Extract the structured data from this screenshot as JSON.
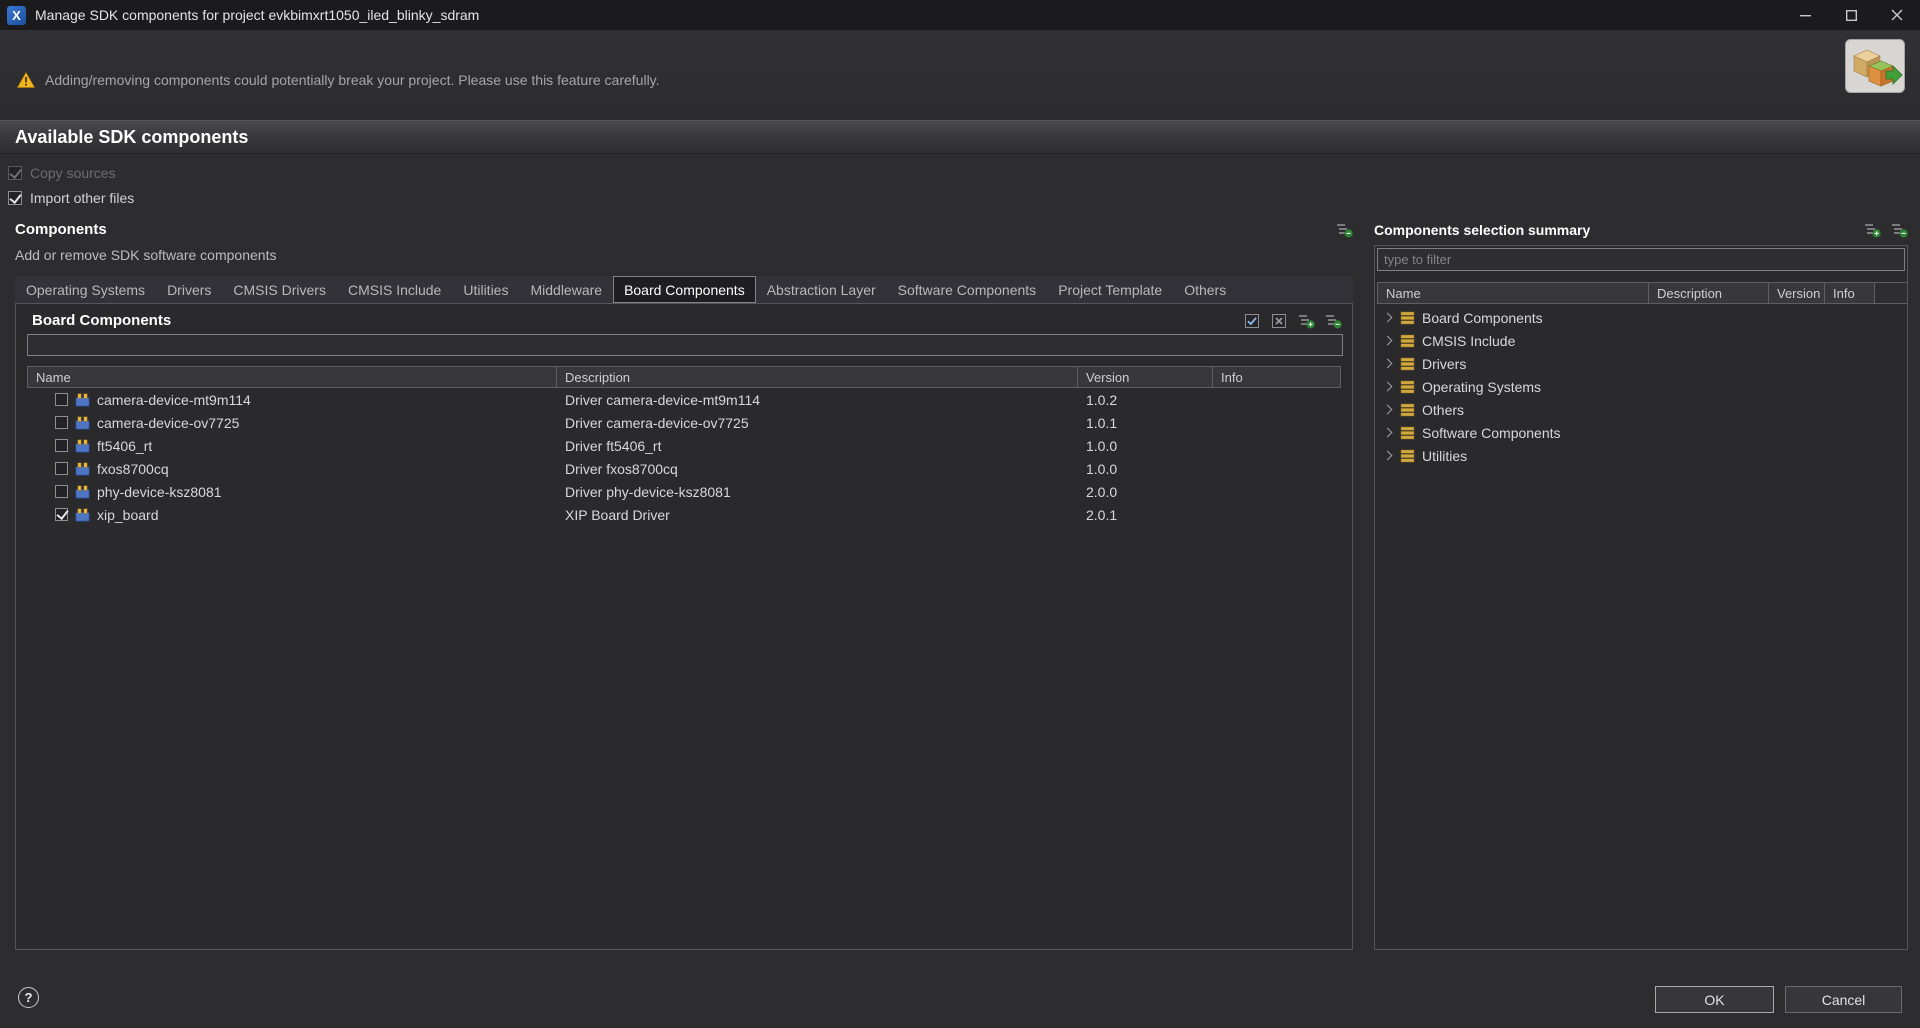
{
  "window": {
    "title": "Manage SDK components for project evkbimxrt1050_iled_blinky_sdram"
  },
  "icons": {
    "app_logo": "X",
    "help": "?"
  },
  "banner": {
    "warning_text": "Adding/removing components could potentially break your project. Please use this feature carefully."
  },
  "page": {
    "title": "Available SDK components"
  },
  "options": [
    {
      "label": "Copy sources",
      "checked": true,
      "disabled": true
    },
    {
      "label": "Import other files",
      "checked": true,
      "disabled": false
    }
  ],
  "components": {
    "title": "Components",
    "subtitle": "Add or remove SDK software components",
    "tabs": [
      {
        "label": "Operating Systems",
        "selected": false
      },
      {
        "label": "Drivers",
        "selected": false
      },
      {
        "label": "CMSIS Drivers",
        "selected": false
      },
      {
        "label": "CMSIS Include",
        "selected": false
      },
      {
        "label": "Utilities",
        "selected": false
      },
      {
        "label": "Middleware",
        "selected": false
      },
      {
        "label": "Board Components",
        "selected": true
      },
      {
        "label": "Abstraction Layer",
        "selected": false
      },
      {
        "label": "Software Components",
        "selected": false
      },
      {
        "label": "Project Template",
        "selected": false
      },
      {
        "label": "Others",
        "selected": false
      }
    ],
    "section_title": "Board Components",
    "filter_value": "",
    "columns": [
      "Name",
      "Description",
      "Version",
      "Info"
    ],
    "rows": [
      {
        "name": "camera-device-mt9m114",
        "description": "Driver camera-device-mt9m114",
        "version": "1.0.2",
        "info": "",
        "checked": false
      },
      {
        "name": "camera-device-ov7725",
        "description": "Driver camera-device-ov7725",
        "version": "1.0.1",
        "info": "",
        "checked": false
      },
      {
        "name": "ft5406_rt",
        "description": "Driver ft5406_rt",
        "version": "1.0.0",
        "info": "",
        "checked": false
      },
      {
        "name": "fxos8700cq",
        "description": "Driver fxos8700cq",
        "version": "1.0.0",
        "info": "",
        "checked": false
      },
      {
        "name": "phy-device-ksz8081",
        "description": "Driver phy-device-ksz8081",
        "version": "2.0.0",
        "info": "",
        "checked": false
      },
      {
        "name": "xip_board",
        "description": "XIP Board Driver",
        "version": "2.0.1",
        "info": "",
        "checked": true
      }
    ]
  },
  "summary": {
    "title": "Components selection summary",
    "filter_placeholder": "type to filter",
    "columns": [
      "Name",
      "Description",
      "Version",
      "Info"
    ],
    "categories": [
      "Board Components",
      "CMSIS Include",
      "Drivers",
      "Operating Systems",
      "Others",
      "Software Components",
      "Utilities"
    ]
  },
  "footer": {
    "ok_label": "OK",
    "cancel_label": "Cancel"
  },
  "colors": {
    "warning": "#efb41e",
    "category_gold": "#d2a93e",
    "component_blue": "#4f74c2",
    "icon_green": "#2f8234"
  }
}
